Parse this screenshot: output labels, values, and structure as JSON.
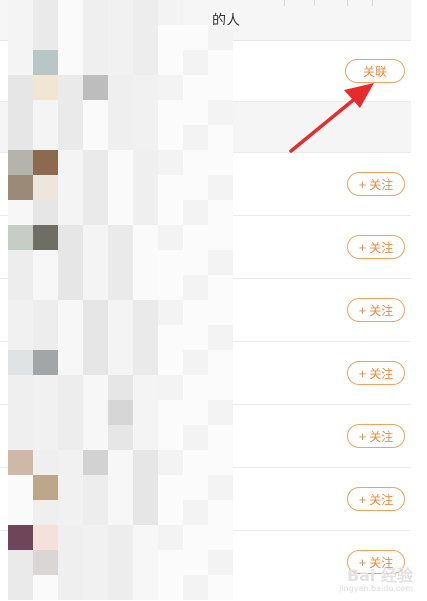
{
  "header": {
    "title": "的人"
  },
  "first_row": {
    "button_label": "关联"
  },
  "follow_rows": [
    {
      "button_label": "关注"
    },
    {
      "button_label": "关注"
    },
    {
      "button_label": "关注"
    },
    {
      "button_label": "关注"
    },
    {
      "button_label": "关注"
    },
    {
      "button_label": "关注"
    },
    {
      "button_label": "关注"
    }
  ],
  "watermark": {
    "main": "Bai 经验",
    "sub": "jingyan.baidu.com"
  },
  "colors": {
    "accent": "#ee8a3a",
    "arrow": "#e52b2b"
  }
}
